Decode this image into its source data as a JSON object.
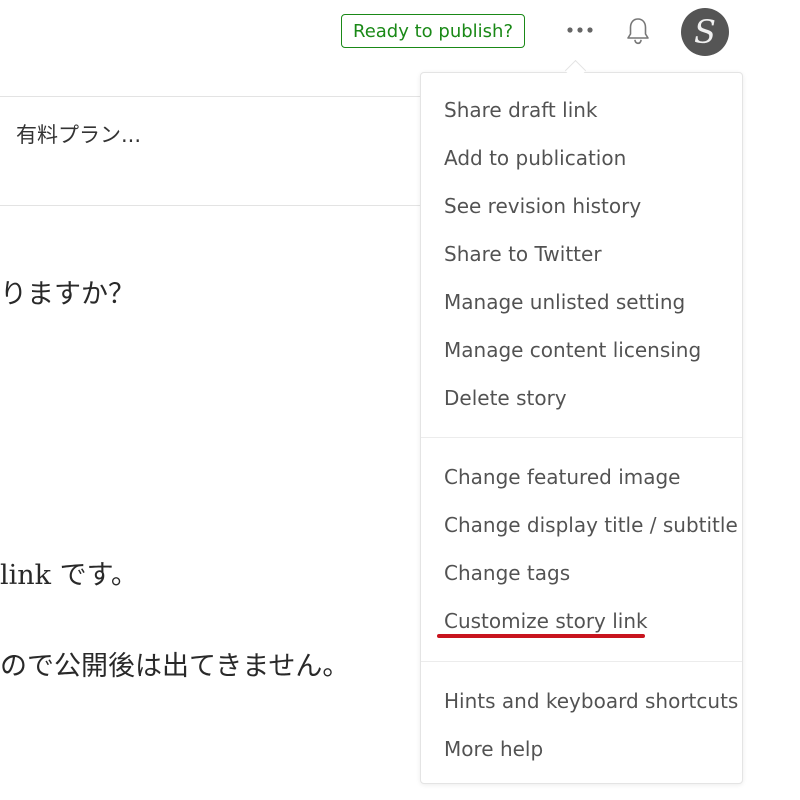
{
  "header": {
    "publish_label": "Ready to publish?",
    "avatar_initial": "S"
  },
  "editor": {
    "card_text": "有料プラン...",
    "lines": [
      "りますか？",
      "link です。",
      "ので公開後は出てきません。"
    ]
  },
  "menu": {
    "group1": [
      "Share draft link",
      "Add to publication",
      "See revision history",
      "Share to Twitter",
      "Manage unlisted setting",
      "Manage content licensing",
      "Delete story"
    ],
    "group2": [
      "Change featured image",
      "Change display title / subtitle",
      "Change tags",
      "Customize story link"
    ],
    "group3": [
      "Hints and keyboard shortcuts",
      "More help"
    ]
  },
  "colors": {
    "accent": "#1a8917",
    "highlight": "#c8141e"
  }
}
